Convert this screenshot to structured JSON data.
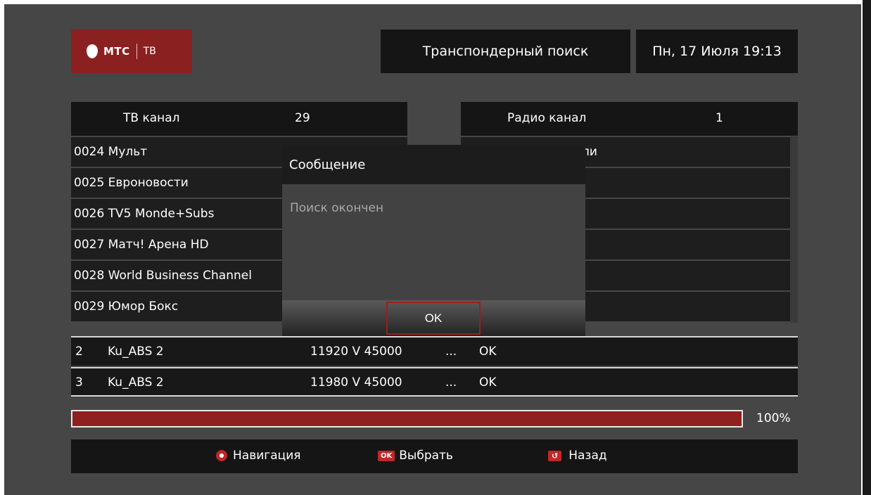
{
  "header": {
    "logo_brand": "МТС",
    "logo_tv": "ТВ",
    "title": "Транспондерный поиск",
    "datetime": "Пн, 17 Июля 19:13"
  },
  "tv_panel": {
    "label": "ТВ канал",
    "count": "29",
    "channels": [
      "0024 Мульт",
      "0025 Евроновости",
      "0026 TV5 Monde+Subs",
      "0027 Матч! Арена HD",
      "0028 World Business Channel",
      "0029 Юмор Бокс"
    ]
  },
  "radio_panel": {
    "label": "Радио канал",
    "count": "1",
    "channels": [
      "ли"
    ]
  },
  "dialog": {
    "title": "Сообщение",
    "message": "Поиск окончен",
    "ok_label": "OK"
  },
  "transponders": [
    {
      "num": "2",
      "sat": "Ku_ABS 2",
      "freq": "11920 V 45000",
      "dots": "...",
      "status": "OK"
    },
    {
      "num": "3",
      "sat": "Ku_ABS 2",
      "freq": "11980 V 45000",
      "dots": "...",
      "status": "OK"
    }
  ],
  "progress": {
    "value": 100,
    "label": "100%"
  },
  "legend": {
    "navigation": "Навигация",
    "ok_icon": "OK",
    "select": "Выбрать",
    "back": "Назад"
  },
  "icons": {
    "nav": "navigation-cross-icon",
    "ok": "ok-button-icon",
    "back": "back-arrow-icon"
  },
  "colors": {
    "accent_red": "#8e2020",
    "background": "#464646",
    "panel": "#151515"
  }
}
